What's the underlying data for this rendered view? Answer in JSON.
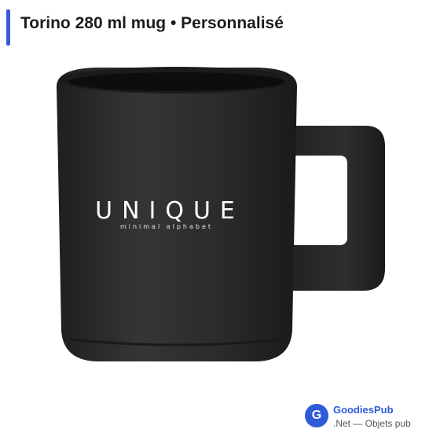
{
  "header": {
    "title": "Torino 280 ml mug • Personnalisé"
  },
  "product": {
    "print_main": "UNIQUE",
    "print_sub": "minimal alphabet",
    "mug_color": "#2b2b2b",
    "print_color": "#ffffff"
  },
  "footer": {
    "logo_letter": "G",
    "brand_name": "GoodiesPub",
    "brand_sub": ".Net — Objets pub",
    "brand_color": "#2f5bd8"
  }
}
